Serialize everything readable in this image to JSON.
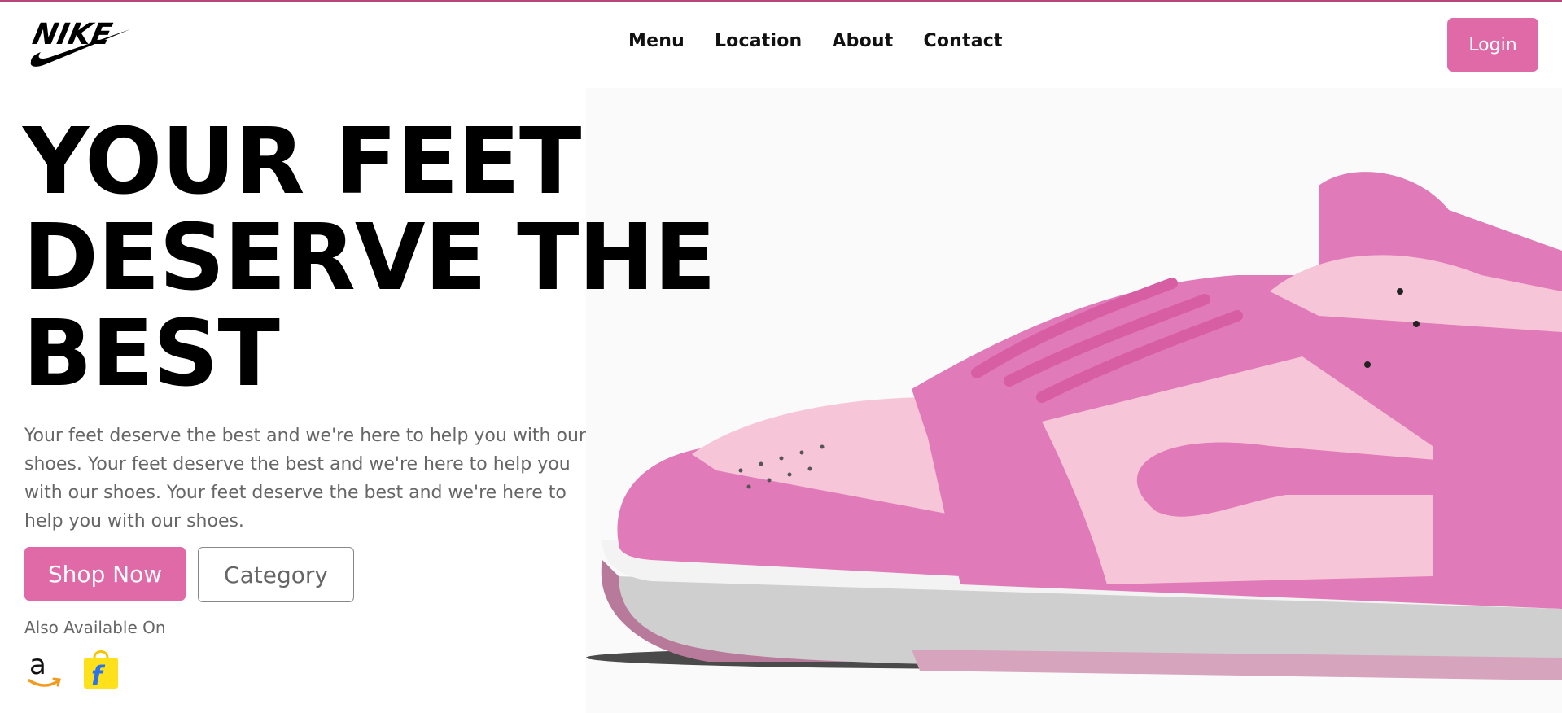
{
  "brand": {
    "logo_text": "NIKE",
    "logo_icon": "nike-swoosh-logo"
  },
  "nav": {
    "items": [
      {
        "label": "Menu"
      },
      {
        "label": "Location"
      },
      {
        "label": "About"
      },
      {
        "label": "Contact"
      }
    ],
    "login_label": "Login"
  },
  "hero": {
    "headline_lines": [
      "YOUR FEET",
      "DESERVE THE",
      "BEST"
    ],
    "description": "Your feet deserve the best and we're here to help you with our shoes. Your feet deserve the best and we're here to help you with our shoes. Your feet deserve the best and we're here to help you with our shoes.",
    "primary_button": "Shop Now",
    "secondary_button": "Category",
    "also_available_label": "Also Available On",
    "stores": [
      {
        "name": "amazon",
        "icon": "amazon-icon"
      },
      {
        "name": "flipkart",
        "icon": "flipkart-icon"
      }
    ],
    "image": "pink-sneaker-image"
  },
  "colors": {
    "accent": "#e06aa8",
    "text_muted": "#666666",
    "shoe_pink": "#e07ab8",
    "shoe_light_pink": "#f6c5d8"
  }
}
